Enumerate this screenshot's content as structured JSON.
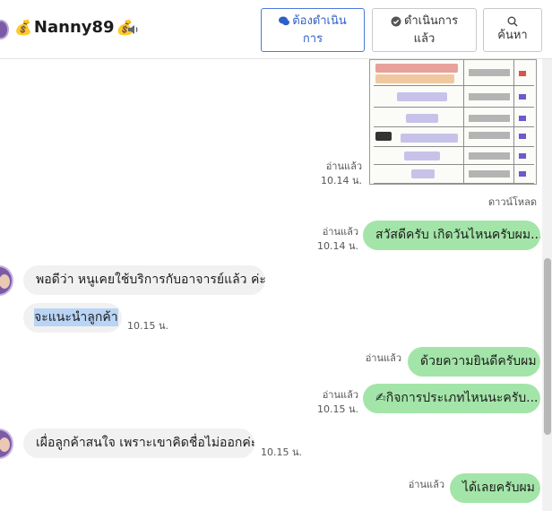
{
  "header": {
    "name": "Nanny89",
    "emoji": "💰",
    "buttons": {
      "todo_line1": "ต้องดำเนิน",
      "todo_line2": "การ",
      "done_line1": "ดำเนินการ",
      "done_line2": "แล้ว",
      "search": "ค้นหา"
    }
  },
  "attachment": {
    "read": "อ่านแล้ว",
    "time": "10.14 น.",
    "download": "ดาวน์โหลด"
  },
  "messages": [
    {
      "side": "out",
      "text": "สวัสดีครับ เกิดวันไหนครับผม...",
      "read": "อ่านแล้ว",
      "time": "10.14 น."
    },
    {
      "side": "in",
      "text": "พอดีว่า หนูเคยใช้บริการกับอาจารย์แล้ว ค่ะ"
    },
    {
      "side": "in",
      "text": "จะแนะนำลูกค้า",
      "time": "10.15 น.",
      "selected": true
    },
    {
      "side": "out",
      "text": "ด้วยความยินดีครับผม",
      "read": "อ่านแล้ว"
    },
    {
      "side": "out",
      "text": "✍กิจการประเภทไหนนะครับ...",
      "read": "อ่านแล้ว",
      "time": "10.15 น."
    },
    {
      "side": "in",
      "text": "เผื่อลูกค้าสนใจ เพราะเขาคิดชื่อไม่ออกค่ะ",
      "time": "10.15 น."
    },
    {
      "side": "out",
      "text": "ได้เลยครับผม",
      "read": "อ่านแล้ว"
    }
  ],
  "colors": {
    "outgoing_bubble": "#a3e5a8",
    "incoming_bubble": "#f1f1f1",
    "primary_button": "#2f5fc8"
  }
}
